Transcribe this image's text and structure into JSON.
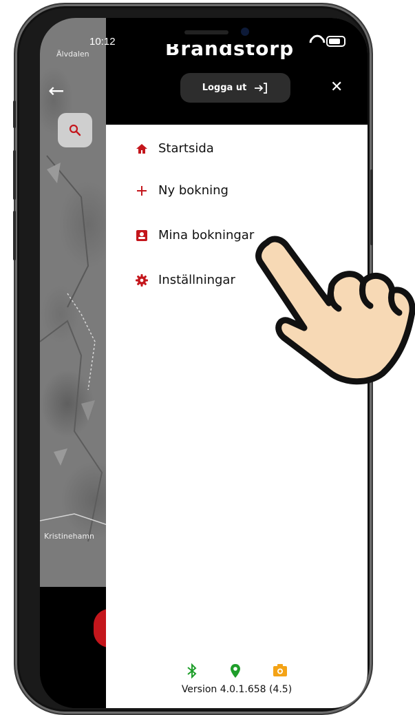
{
  "status_bar": {
    "time": "10:12"
  },
  "map": {
    "labels": [
      "Älvdalen",
      "Kristinehamn"
    ]
  },
  "drawer": {
    "brand": "Brandstorp rental",
    "logout_label": "Logga ut",
    "menu": [
      {
        "label": "Startsida",
        "icon": "home-icon"
      },
      {
        "label": "Ny bokning",
        "icon": "plus-icon"
      },
      {
        "label": "Mina bokningar",
        "icon": "contact-card-icon"
      },
      {
        "label": "Inställningar",
        "icon": "gear-icon"
      }
    ],
    "footer": {
      "icons": [
        {
          "name": "bluetooth-icon",
          "color": "#1e9e2a"
        },
        {
          "name": "location-pin-icon",
          "color": "#1e9e2a"
        },
        {
          "name": "camera-icon",
          "color": "#f4a316"
        }
      ],
      "version": "Version 4.0.1.658  (4.5)"
    }
  },
  "colors": {
    "accent": "#c4161c",
    "drawer_header": "#000000",
    "logout_button": "#2d2d2d"
  }
}
